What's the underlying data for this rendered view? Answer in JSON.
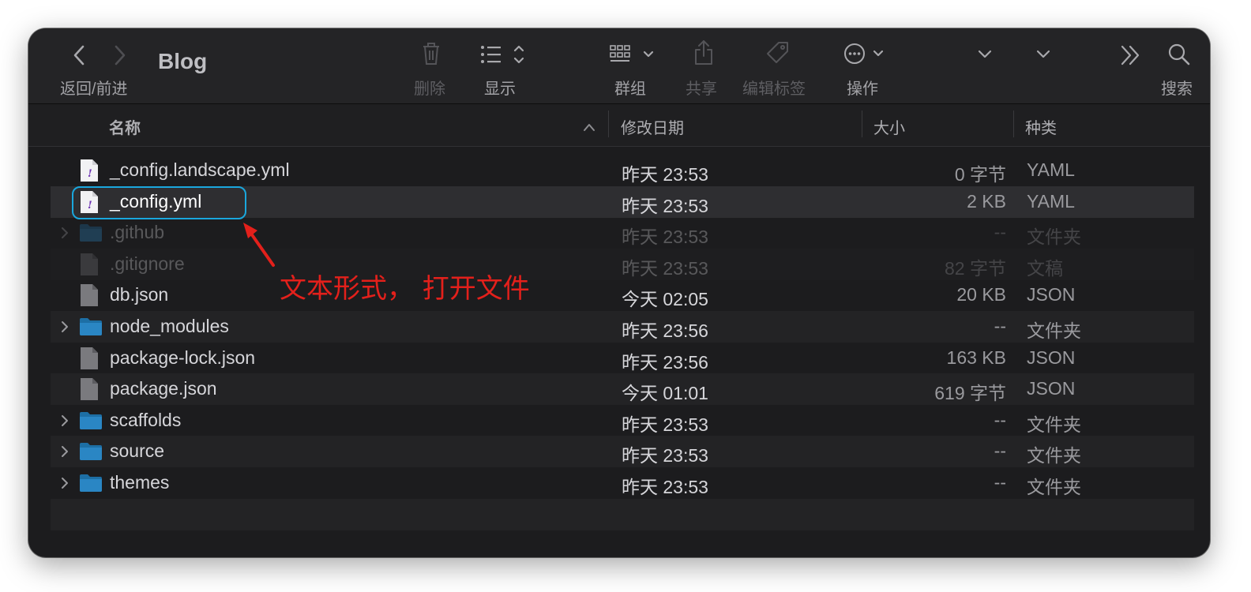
{
  "window": {
    "title": "Blog"
  },
  "toolbar": {
    "back_forward_label": "返回/前进",
    "delete_label": "删除",
    "view_label": "显示",
    "group_label": "群组",
    "share_label": "共享",
    "tags_label": "编辑标签",
    "action_label": "操作",
    "search_label": "搜索"
  },
  "columns": {
    "name": "名称",
    "date": "修改日期",
    "size": "大小",
    "kind": "种类"
  },
  "files": [
    {
      "name": "_config.landscape.yml",
      "date": "昨天 23:53",
      "size": "0 字节",
      "kind": "YAML",
      "type": "yaml",
      "folder": false,
      "ghost": false
    },
    {
      "name": "_config.yml",
      "date": "昨天 23:53",
      "size": "2 KB",
      "kind": "YAML",
      "type": "yaml",
      "folder": false,
      "ghost": false,
      "selected": true
    },
    {
      "name": ".github",
      "date": "昨天 23:53",
      "size": "--",
      "kind": "文件夹",
      "type": "folder",
      "folder": true,
      "ghost": true
    },
    {
      "name": ".gitignore",
      "date": "昨天 23:53",
      "size": "82 字节",
      "kind": "文稿",
      "type": "doc",
      "folder": false,
      "ghost": true
    },
    {
      "name": "db.json",
      "date": "今天 02:05",
      "size": "20 KB",
      "kind": "JSON",
      "type": "doc",
      "folder": false,
      "ghost": false
    },
    {
      "name": "node_modules",
      "date": "昨天 23:56",
      "size": "--",
      "kind": "文件夹",
      "type": "folder",
      "folder": true,
      "ghost": false
    },
    {
      "name": "package-lock.json",
      "date": "昨天 23:56",
      "size": "163 KB",
      "kind": "JSON",
      "type": "doc",
      "folder": false,
      "ghost": false
    },
    {
      "name": "package.json",
      "date": "今天 01:01",
      "size": "619 字节",
      "kind": "JSON",
      "type": "doc",
      "folder": false,
      "ghost": false
    },
    {
      "name": "scaffolds",
      "date": "昨天 23:53",
      "size": "--",
      "kind": "文件夹",
      "type": "folder",
      "folder": true,
      "ghost": false
    },
    {
      "name": "source",
      "date": "昨天 23:53",
      "size": "--",
      "kind": "文件夹",
      "type": "folder",
      "folder": true,
      "ghost": false
    },
    {
      "name": "themes",
      "date": "昨天 23:53",
      "size": "--",
      "kind": "文件夹",
      "type": "folder",
      "folder": true,
      "ghost": false
    }
  ],
  "annotation": {
    "text": "文本形式， 打开文件",
    "color": "#e3201b",
    "box_color": "#1aa7dd"
  },
  "icons": {
    "back": "chevron-left-icon",
    "forward": "chevron-right-icon",
    "delete": "trash-icon",
    "view": "list-view-icon",
    "group": "grid-group-icon",
    "share": "share-icon",
    "tags": "tag-icon",
    "action": "ellipsis-circle-icon",
    "more": "double-chevron-right-icon",
    "search": "magnifier-icon"
  }
}
